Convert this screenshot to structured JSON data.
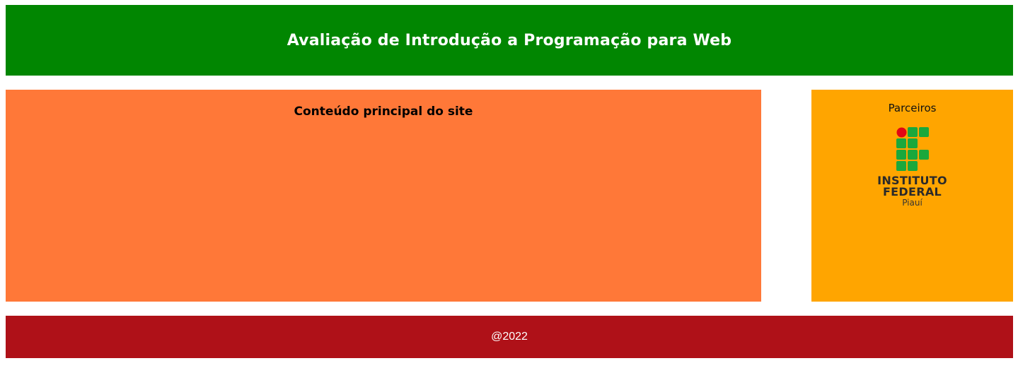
{
  "colors": {
    "header_bg": "#018601",
    "main_bg": "#ff7838",
    "aside_bg": "#ffa500",
    "footer_bg": "#af1118",
    "logo_green": "#1aa83c",
    "logo_red": "#e30613"
  },
  "header": {
    "title": "Avaliação de Introdução a Programação para Web"
  },
  "main": {
    "title": "Conteúdo principal do site"
  },
  "aside": {
    "title": "Parceiros",
    "logo": {
      "icon": "instituto-federal-logo",
      "line1": "INSTITUTO",
      "line2": "FEDERAL",
      "line3": "Piauí"
    }
  },
  "footer": {
    "text": "@2022"
  }
}
